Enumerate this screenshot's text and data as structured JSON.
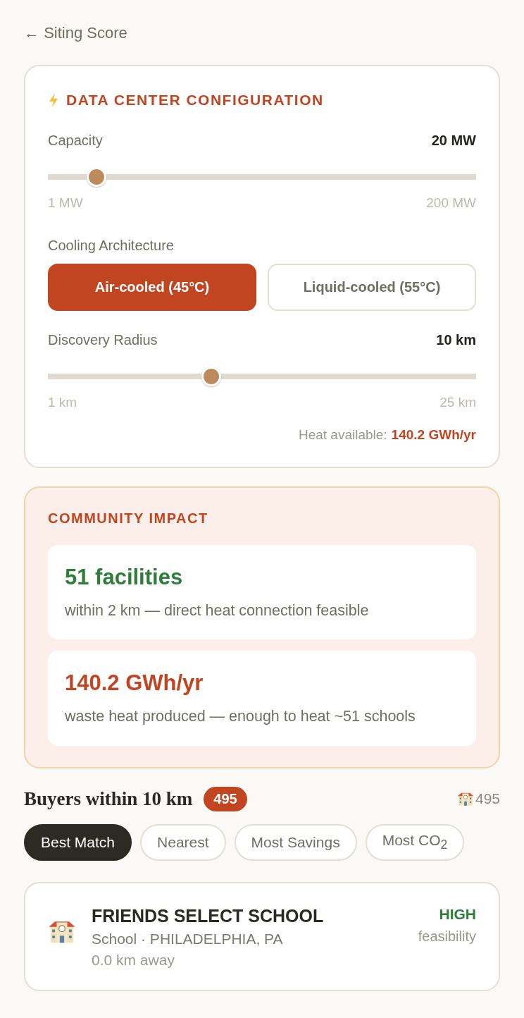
{
  "back_link": {
    "arrow": "←",
    "label": "Siting Score"
  },
  "configuration": {
    "title": "DATA CENTER CONFIGURATION",
    "capacity": {
      "label": "Capacity",
      "value": "20 MW",
      "level": 0.095,
      "min": "1 MW",
      "max": "200 MW"
    },
    "cooling": {
      "label": "Cooling Architecture",
      "options": [
        {
          "label": "Air-cooled (45°C)",
          "selected": true
        },
        {
          "label": "Liquid-cooled (55°C)",
          "selected": false
        }
      ]
    },
    "radius": {
      "label": "Discovery Radius",
      "value": "10 km",
      "level": 0.375,
      "min": "1 km",
      "max": "25 km"
    },
    "heat": {
      "label": "Heat available:",
      "value": "140.2 GWh/yr"
    }
  },
  "community_impact": {
    "title": "COMMUNITY IMPACT",
    "stats": [
      {
        "value": "51 facilities",
        "description": "within 2 km — direct heat connection feasible",
        "color": "#2e7d3a"
      },
      {
        "value": "140.2 GWh/yr",
        "description": "waste heat produced — enough to heat ~51 schools",
        "color": "#c24522"
      }
    ]
  },
  "buyers": {
    "title": "Buyers within 10 km",
    "count": "495",
    "school_count": "495",
    "sort_options": [
      {
        "label": "Best Match",
        "selected": true
      },
      {
        "label": "Nearest",
        "selected": false
      },
      {
        "label": "Most Savings",
        "selected": false
      },
      {
        "label": "Most CO$_{2}$",
        "selected": false
      }
    ],
    "results": [
      {
        "name": "FRIENDS SELECT SCHOOL",
        "details": "School · PHILADELPHIA, PA",
        "distance": "0.0 km away",
        "feasibility": "HIGH",
        "feasibility_label": "feasibility"
      }
    ]
  }
}
